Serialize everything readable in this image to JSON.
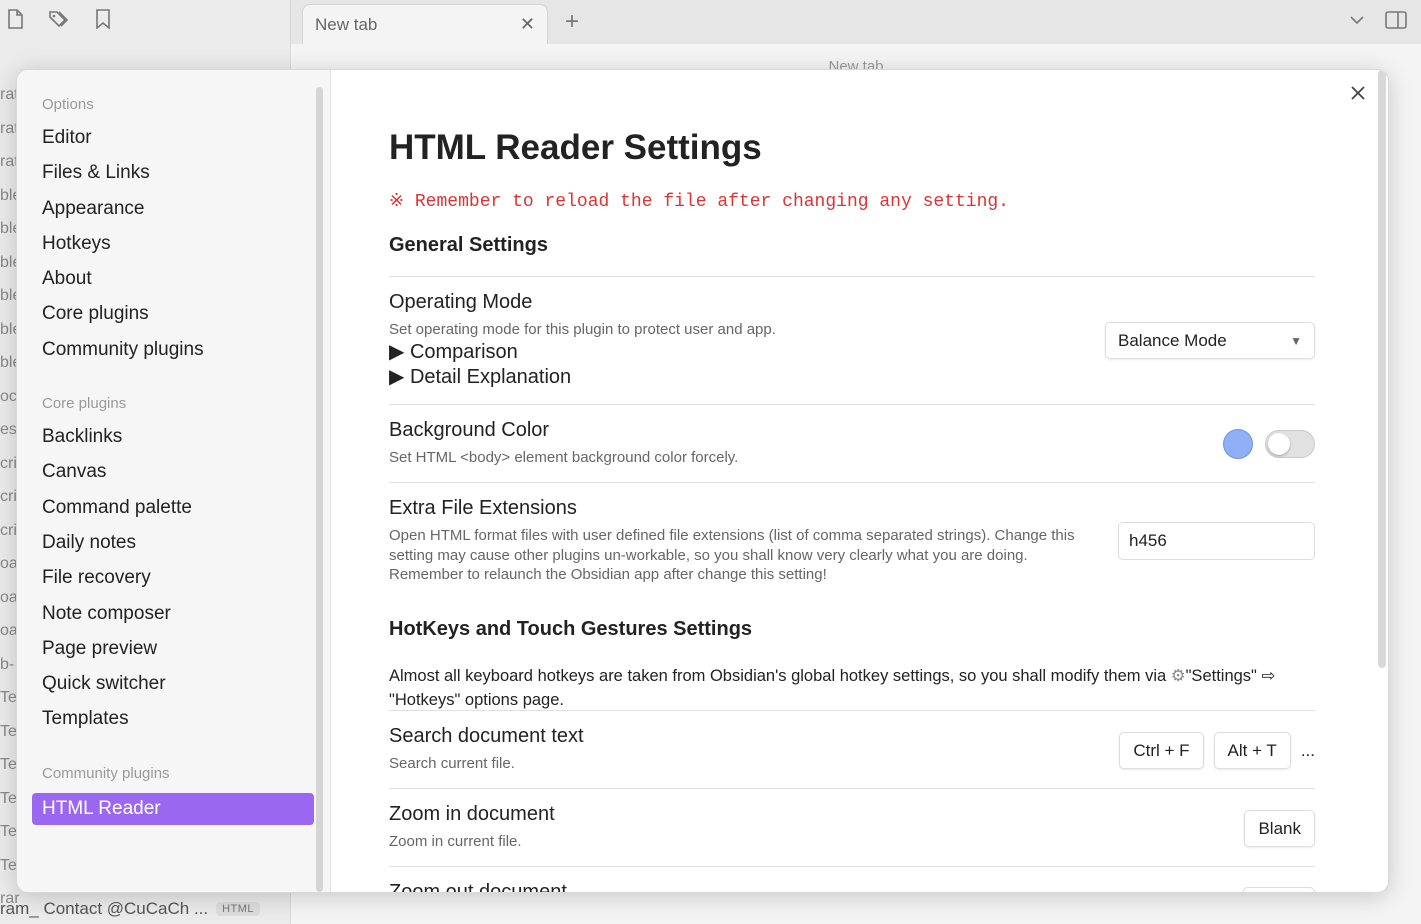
{
  "background": {
    "tab_label": "New tab",
    "tab_close": "✕",
    "new_tab_symbol": "+",
    "main_title": "New tab",
    "left_partial_rows": [
      "rat",
      "rat",
      "rat",
      "ble",
      "ble",
      "ble",
      "ble",
      "ble",
      "ble",
      "oc",
      "es",
      "cri",
      "cri",
      "cri",
      "oar",
      "oar",
      "oar",
      "b-",
      "Te",
      "Te",
      "Te",
      "Te",
      "Te",
      "Te",
      "rar"
    ],
    "bottom_file_name": "ram_ Contact @CuCaCh ...",
    "bottom_file_badge": "HTML"
  },
  "sidebar": {
    "options_title": "Options",
    "options_items": [
      "Editor",
      "Files & Links",
      "Appearance",
      "Hotkeys",
      "About",
      "Core plugins",
      "Community plugins"
    ],
    "core_title": "Core plugins",
    "core_items": [
      "Backlinks",
      "Canvas",
      "Command palette",
      "Daily notes",
      "File recovery",
      "Note composer",
      "Page preview",
      "Quick switcher",
      "Templates"
    ],
    "community_title": "Community plugins",
    "community_items": [
      "HTML Reader"
    ]
  },
  "content": {
    "title": "HTML Reader Settings",
    "reload_note": "※ Remember to reload the file after changing any setting.",
    "general_heading": "General Settings",
    "operating_mode": {
      "name": "Operating Mode",
      "desc": "Set operating mode for this plugin to protect user and app.",
      "details_1": "Comparison",
      "details_2": "Detail Explanation",
      "selected": "Balance Mode"
    },
    "background_color": {
      "name": "Background Color",
      "desc": "Set HTML <body> element background color forcely.",
      "swatch_color": "#8fb0f7",
      "toggle_on": false
    },
    "extra_ext": {
      "name": "Extra File Extensions",
      "desc": "Open HTML format files with user defined file extensions (list of comma separated strings). Change this setting may cause other plugins un-workable, so you shall know very clearly what you are doing. Remember to relaunch the Obsidian app after change this setting!",
      "value": "h456"
    },
    "hotkeys_heading": "HotKeys and Touch Gestures Settings",
    "hotkeys_note_1": "Almost all keyboard hotkeys are taken from Obsidian's global hotkey settings, so you shall modify them via ",
    "hotkeys_note_2": "\"Settings\" ⇨ \"Hotkeys\" options page.",
    "search": {
      "name": "Search document text",
      "desc": "Search current file.",
      "key1": "Ctrl + F",
      "key2": "Alt + T",
      "more": "..."
    },
    "zoom_in": {
      "name": "Zoom in document",
      "desc": "Zoom in current file.",
      "key1": "Blank"
    },
    "zoom_out": {
      "name": "Zoom out document"
    }
  }
}
